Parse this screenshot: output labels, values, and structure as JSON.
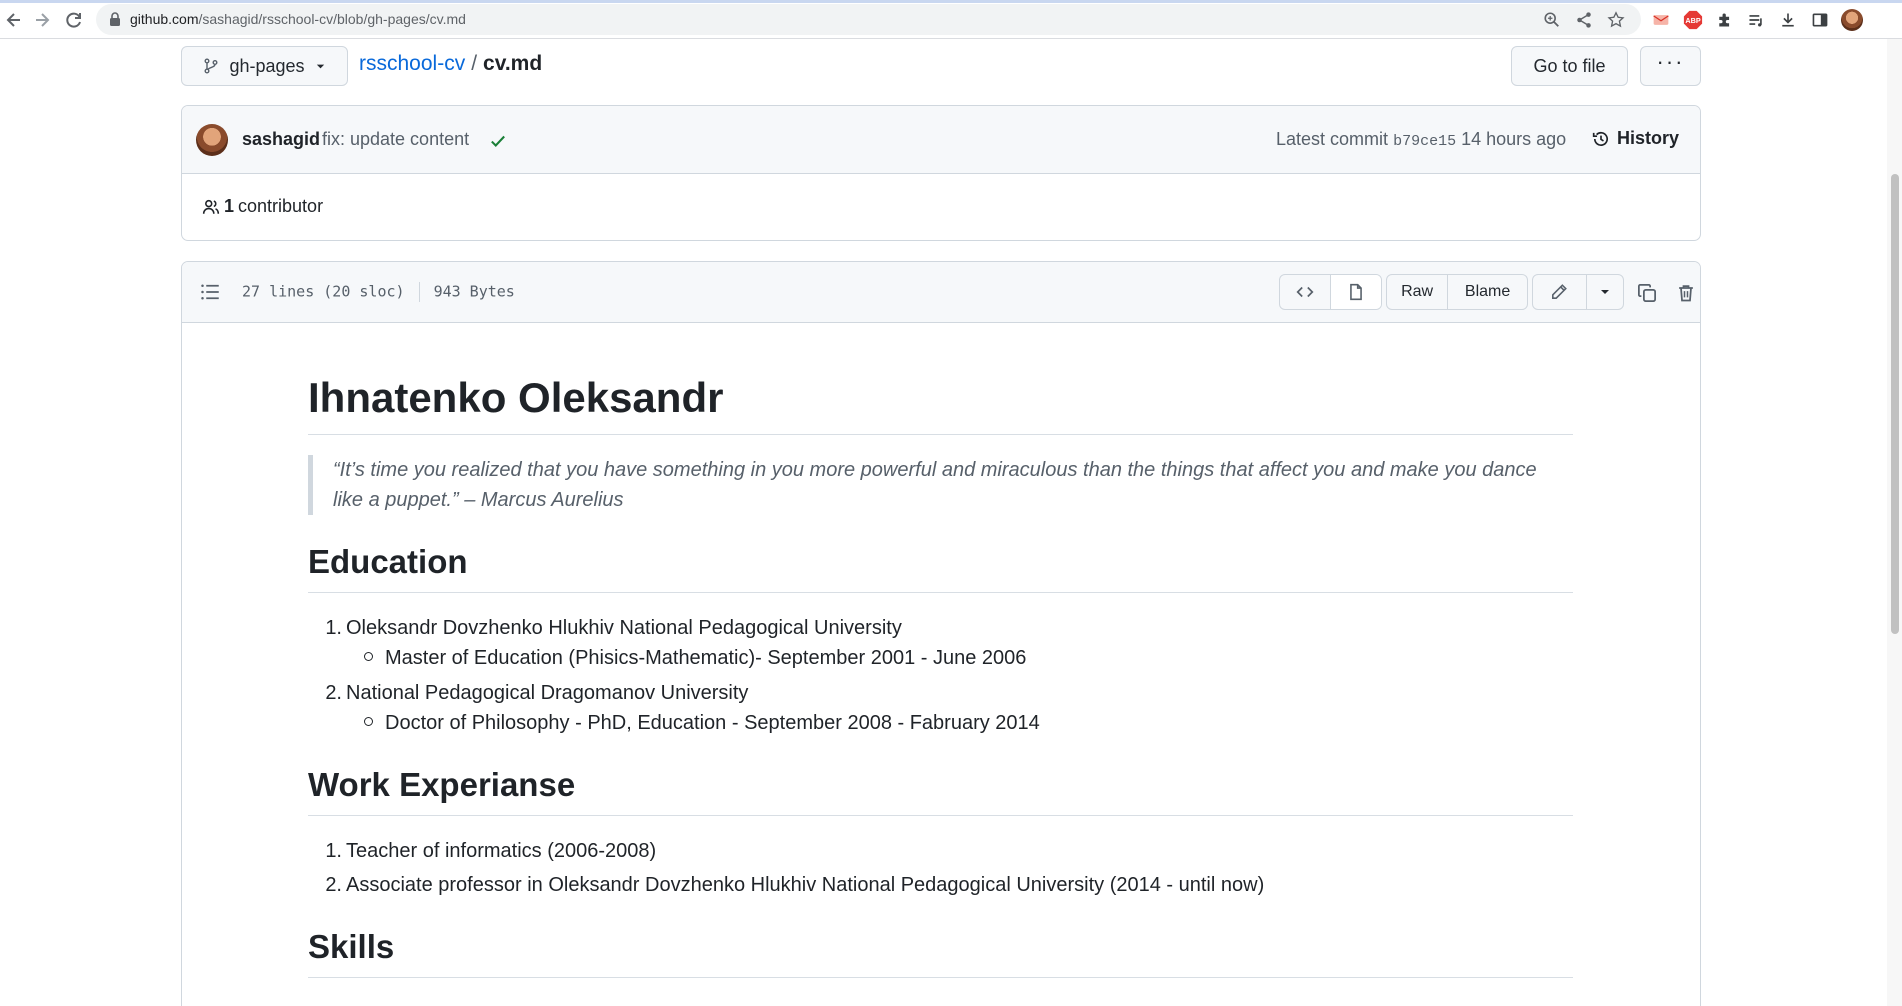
{
  "browser": {
    "url_host": "github.com",
    "url_path": "/sashagid/rsschool-cv/blob/gh-pages/cv.md"
  },
  "header": {
    "branch": "gh-pages",
    "repo": "rsschool-cv",
    "separator": "/",
    "file": "cv.md",
    "go_to_file": "Go to file",
    "more": "···"
  },
  "commit": {
    "author": "sashagid",
    "message": "fix: update content",
    "latest_label": "Latest commit",
    "sha": "b79ce15",
    "time": "14 hours ago",
    "history": "History",
    "contributors_count": "1",
    "contributors_label": "contributor"
  },
  "file": {
    "lines": "27 lines (20 sloc)",
    "size": "943 Bytes",
    "raw": "Raw",
    "blame": "Blame"
  },
  "markdown": {
    "title": "Ihnatenko Oleksandr",
    "quote_line1": "“It’s time you realized that you have something in you more powerful and miraculous than the things that affect you and make you dance",
    "quote_line2": "like a puppet.” – Marcus Aurelius",
    "education": {
      "heading": "Education",
      "items": [
        {
          "marker": "1.",
          "text": "Oleksandr Dovzhenko Hlukhiv National Pedagogical University",
          "sub": "Master of Education (Phisics-Mathematic)- September 2001 - June 2006"
        },
        {
          "marker": "2.",
          "text": "National Pedagogical Dragomanov University",
          "sub": "Doctor of Philosophy - PhD, Education - September 2008 - Fabruary 2014"
        }
      ]
    },
    "work": {
      "heading": "Work Experianse",
      "items": [
        {
          "marker": "1.",
          "text": "Teacher of informatics (2006-2008)"
        },
        {
          "marker": "2.",
          "text": "Associate professor in Oleksandr Dovzhenko Hlukhiv National Pedagogical University (2014 - until now)"
        }
      ]
    },
    "skills": {
      "heading": "Skills"
    }
  },
  "colors": {
    "link": "#0969da",
    "success": "#1a7f37",
    "border": "#d0d7de",
    "header_bg": "#f6f8fa"
  }
}
